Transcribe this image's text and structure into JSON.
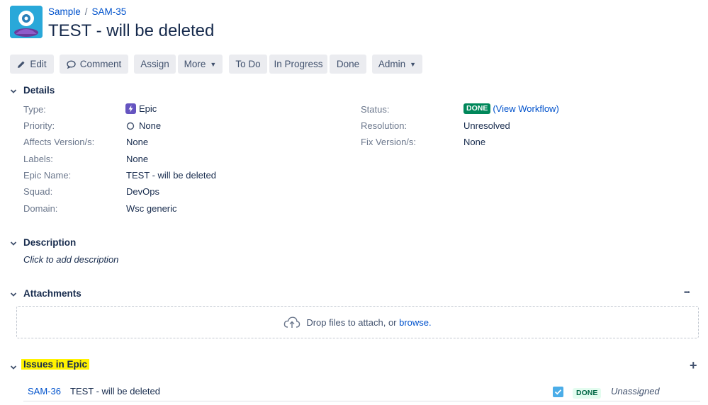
{
  "breadcrumb": {
    "project": "Sample",
    "issue_key": "SAM-35"
  },
  "issue": {
    "title": "TEST - will be deleted"
  },
  "toolbar": {
    "edit": "Edit",
    "comment": "Comment",
    "assign": "Assign",
    "more": "More",
    "todo": "To Do",
    "in_progress": "In Progress",
    "done": "Done",
    "admin": "Admin"
  },
  "details": {
    "heading": "Details",
    "left": [
      {
        "label": "Type:",
        "value": "Epic"
      },
      {
        "label": "Priority:",
        "value": "None"
      },
      {
        "label": "Affects Version/s:",
        "value": "None"
      },
      {
        "label": "Labels:",
        "value": "None"
      },
      {
        "label": "Epic Name:",
        "value": "TEST - will be deleted"
      },
      {
        "label": "Squad:",
        "value": "DevOps"
      },
      {
        "label": "Domain:",
        "value": "Wsc generic"
      }
    ],
    "right": [
      {
        "label": "Status:",
        "value": "DONE",
        "link": "(View Workflow)"
      },
      {
        "label": "Resolution:",
        "value": "Unresolved"
      },
      {
        "label": "Fix Version/s:",
        "value": "None"
      }
    ]
  },
  "description": {
    "heading": "Description",
    "placeholder": "Click to add description"
  },
  "attachments": {
    "heading": "Attachments",
    "more": "•••",
    "drop_text": "Drop files to attach, or",
    "browse": "browse."
  },
  "issues_in_epic": {
    "heading": "Issues in Epic",
    "add": "+",
    "rows": [
      {
        "key": "SAM-36",
        "summary": "TEST - will be deleted",
        "status": "DONE",
        "assignee": "Unassigned"
      }
    ]
  },
  "colors": {
    "link": "#0052cc",
    "done": "#00875a",
    "epic": "#6554c0",
    "highlight": "#fff200"
  }
}
